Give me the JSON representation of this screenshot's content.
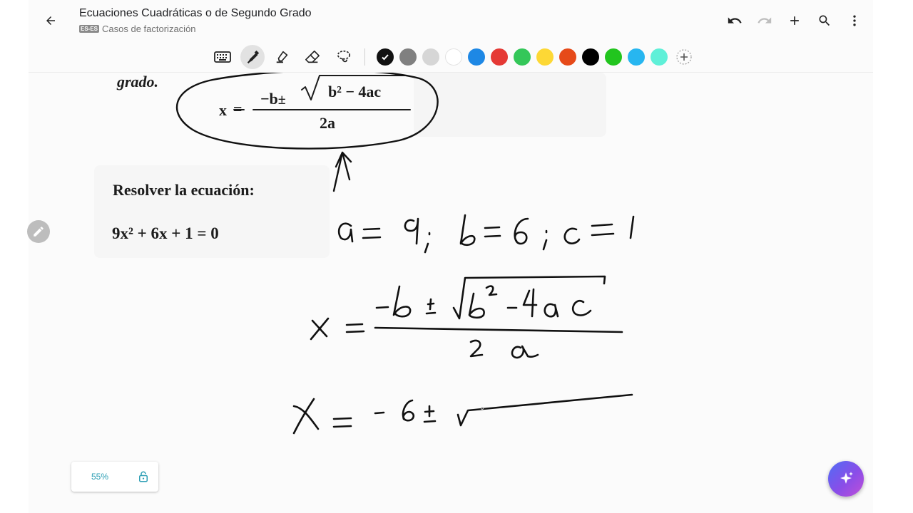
{
  "header": {
    "title": "Ecuaciones Cuadráticas o de Segundo Grado",
    "language_badge": "ES-ES",
    "subtitle": "Casos de factorización",
    "icons": [
      "back-arrow-icon",
      "undo-icon",
      "redo-icon",
      "add-icon",
      "search-icon",
      "more-vert-icon"
    ]
  },
  "toolbar": {
    "tools": [
      "keyboard-icon",
      "pen-icon",
      "highlighter-icon",
      "eraser-icon",
      "lasso-icon"
    ],
    "active_tool": "pen-icon",
    "colors": [
      "#111111",
      "#808080",
      "#d6d6d6",
      "#ffffff",
      "#1e88e5",
      "#e53935",
      "#34c759",
      "#fdd835",
      "#e64a19",
      "#000000",
      "#22c51e",
      "#27b6f0",
      "#5ff0d8"
    ],
    "selected_color": "#111111",
    "add_color_icon": "add-circle-icon"
  },
  "document": {
    "grado": "grado.",
    "formula": {
      "x": "x",
      "minus_b": "−b",
      "pm": "±",
      "radicand": "b² − 4ac",
      "denominator": "2a"
    },
    "resolver": "Resolver la ecuación:",
    "equation": "9x² + 6x + 1 = 0"
  },
  "footer": {
    "zoom": "55%",
    "lock_icon": "lock-open-icon",
    "ai_button_icon": "sparkle-icon"
  }
}
